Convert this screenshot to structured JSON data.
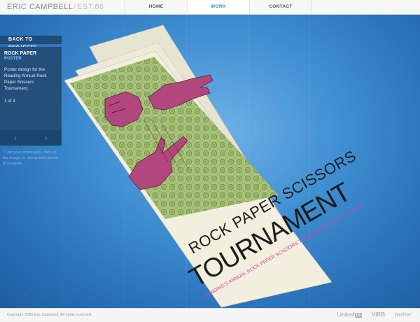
{
  "brand": {
    "name": "ERIC CAMPBELL",
    "separator": "/",
    "est": "EST.86"
  },
  "nav": [
    {
      "label": "HOME",
      "active": false
    },
    {
      "label": "WORK",
      "active": true
    },
    {
      "label": "CONTACT",
      "active": false
    }
  ],
  "sidebar": {
    "back_label": "BACK TO PROJECTS",
    "project_title": "ROCK PAPER",
    "project_type": "POSTER",
    "description": "Poster design for the Reading Annual Rock Paper Scissors Tournament.",
    "counter": "1 of 4",
    "prev_icon": "‹",
    "next_icon": "›",
    "hint": "* Use your arrow keys, click on the image, or use arrows above to navigate."
  },
  "poster": {
    "headline_1": "ROCK PAPER SCISSORS",
    "headline_2": "TOURNAMENT",
    "tagline": "READING'S ANNUAL ROCK PAPER SCISSORS TOURNAMENT 10.02.07 9:00 AM",
    "colors": {
      "paper": "#f3efdf",
      "pattern": "#a9c27a",
      "hand": "#b2477d",
      "ink": "#1c1c1c",
      "accent": "#d8449b"
    }
  },
  "footer": {
    "copyright": "Copyright 2009 Eric Campbell. All rights reserved.",
    "social": {
      "linkedin_prefix": "Linked",
      "linkedin_box": "in",
      "virb": "VIRB",
      "twitter": "twitter"
    }
  }
}
